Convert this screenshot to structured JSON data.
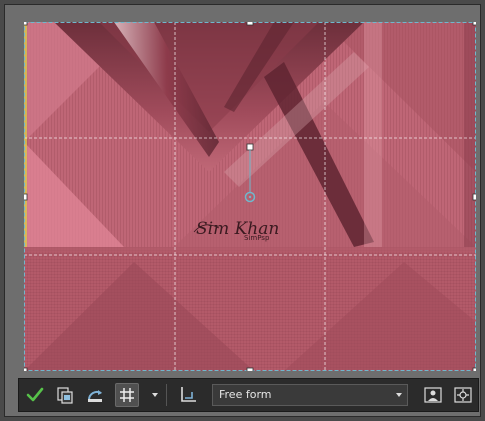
{
  "canvas": {
    "background": "#c06877",
    "signature_text": "Sim Khan",
    "signature_subtext": "SimPsp"
  },
  "crop": {
    "border_color": "#6fb8cc",
    "handle_color": "#6fb8cc",
    "grid_color": "#ffffff"
  },
  "toolbar": {
    "apply_icon": "checkmark-icon",
    "crop_as_new_icon": "crop-as-new-icon",
    "rotate_icon": "rotate-icon",
    "grid_icon": "grid-icon",
    "snap_icon": "ruler-icon",
    "aspect_mode": "Free form",
    "portrait_icon": "portrait-icon",
    "options_icon": "options-icon",
    "accent": "#4caf50"
  }
}
